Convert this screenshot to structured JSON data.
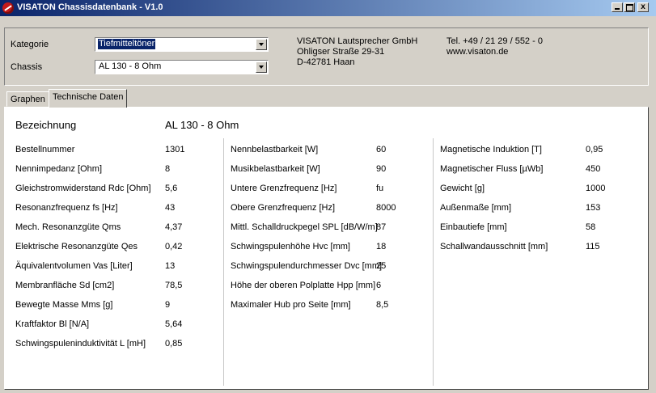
{
  "window": {
    "title": "VISATON Chassisdatenbank - V1.0",
    "buttons": {
      "minimize": "",
      "maximize": "",
      "close": "x"
    }
  },
  "filters": {
    "kategorie_label": "Kategorie",
    "kategorie_value": "Tiefmitteltöner",
    "chassis_label": "Chassis",
    "chassis_value": "AL 130 - 8 Ohm"
  },
  "company": {
    "name": "VISATON Lautsprecher GmbH",
    "street": "Ohligser Straße 29-31",
    "city": "D-42781 Haan",
    "phone": "Tel. +49 / 21 29 / 552 - 0",
    "web": "www.visaton.de"
  },
  "tabs": [
    {
      "label": "Graphen",
      "active": false
    },
    {
      "label": "Technische Daten",
      "active": true
    }
  ],
  "specs": {
    "bezeichnung_label": "Bezeichnung",
    "bezeichnung_value": "AL 130 - 8 Ohm",
    "columns": [
      [
        {
          "label": "Bestellnummer",
          "value": "1301"
        },
        {
          "label": "Nennimpedanz [Ohm]",
          "value": "8"
        },
        {
          "label": "Gleichstromwiderstand Rdc [Ohm]",
          "value": "5,6"
        },
        {
          "label": "Resonanzfrequenz fs [Hz]",
          "value": "43"
        },
        {
          "label": "Mech. Resonanzgüte Qms",
          "value": "4,37"
        },
        {
          "label": "Elektrische Resonanzgüte Qes",
          "value": "0,42"
        },
        {
          "label": "Äquivalentvolumen Vas [Liter]",
          "value": "13"
        },
        {
          "label": "Membranfläche Sd [cm2]",
          "value": "78,5"
        },
        {
          "label": "Bewegte Masse Mms [g]",
          "value": "9"
        },
        {
          "label": "Kraftfaktor Bl [N/A]",
          "value": "5,64"
        },
        {
          "label": "Schwingspuleninduktivität L [mH]",
          "value": "0,85"
        }
      ],
      [
        {
          "label": "Nennbelastbarkeit [W]",
          "value": "60"
        },
        {
          "label": "Musikbelastbarkeit [W]",
          "value": "90"
        },
        {
          "label": "Untere Grenzfrequenz [Hz]",
          "value": "fu"
        },
        {
          "label": "Obere Grenzfrequenz [Hz]",
          "value": "8000"
        },
        {
          "label": "Mittl. Schalldruckpegel SPL [dB/W/m]",
          "value": "87"
        },
        {
          "label": "Schwingspulenhöhe Hvc [mm]",
          "value": "18"
        },
        {
          "label": "Schwingspulendurchmesser Dvc [mm]",
          "value": "25"
        },
        {
          "label": "Höhe der oberen Polplatte Hpp [mm]",
          "value": "6"
        },
        {
          "label": "Maximaler Hub pro Seite [mm]",
          "value": "8,5"
        }
      ],
      [
        {
          "label": "Magnetische Induktion [T]",
          "value": "0,95"
        },
        {
          "label": "Magnetischer Fluss [µWb]",
          "value": "450"
        },
        {
          "label": "Gewicht [g]",
          "value": "1000"
        },
        {
          "label": "Außenmaße [mm]",
          "value": "153"
        },
        {
          "label": "Einbautiefe [mm]",
          "value": "58"
        },
        {
          "label": "Schallwandausschnitt [mm]",
          "value": "115"
        }
      ]
    ]
  },
  "colors": {
    "titlebar_start": "#0a246a",
    "titlebar_end": "#a6caf0",
    "face": "#d4d0c8",
    "selection": "#0a246a"
  }
}
